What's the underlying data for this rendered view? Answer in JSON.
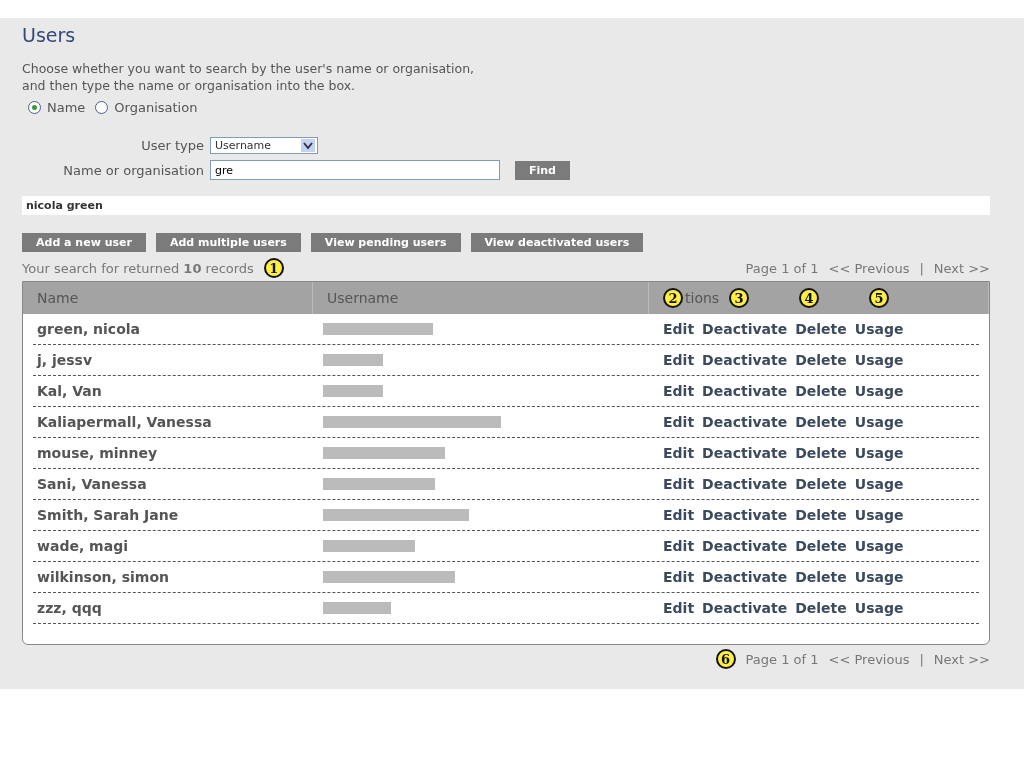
{
  "title": "Users",
  "description": "Choose whether you want to search by the user's name or organisation,\nand then type the name or organisation into the box.",
  "search_by": [
    {
      "label": "Name",
      "selected": true
    },
    {
      "label": "Organisation",
      "selected": false
    }
  ],
  "user_type": {
    "label": "User type",
    "value": "Username"
  },
  "name_field": {
    "label": "Name or organisation",
    "value": "gre"
  },
  "find_button": "Find",
  "suggestion": "nicola green",
  "buttons": [
    "Add a new user",
    "Add multiple users",
    "View pending users",
    "View deactivated users"
  ],
  "result_summary": {
    "before": "Your search for returned ",
    "count": "10",
    "after": " records",
    "marker": "1"
  },
  "pagination_top": {
    "page": "Page 1 of 1",
    "previous": "<< Previous",
    "separator": "|",
    "next": "Next >>"
  },
  "columns": [
    {
      "label": "Name"
    },
    {
      "label": "Username"
    },
    {
      "label": "tions",
      "marker": "2"
    }
  ],
  "action_markers": [
    "3",
    "4",
    "5"
  ],
  "rows": [
    {
      "name": "green, nicola",
      "actions": [
        "Edit",
        "Deactivate",
        "Delete",
        "Usage"
      ]
    },
    {
      "name": "j, jessv",
      "actions": [
        "Edit",
        "Deactivate",
        "Delete",
        "Usage"
      ]
    },
    {
      "name": "Kal, Van",
      "actions": [
        "Edit",
        "Deactivate",
        "Delete",
        "Usage"
      ]
    },
    {
      "name": "Kaliapermall, Vanessa",
      "actions": [
        "Edit",
        "Deactivate",
        "Delete",
        "Usage"
      ]
    },
    {
      "name": "mouse, minney",
      "actions": [
        "Edit",
        "Deactivate",
        "Delete",
        "Usage"
      ]
    },
    {
      "name": "Sani, Vanessa",
      "actions": [
        "Edit",
        "Deactivate",
        "Delete",
        "Usage"
      ]
    },
    {
      "name": "Smith, Sarah Jane",
      "actions": [
        "Edit",
        "Deactivate",
        "Delete",
        "Usage"
      ]
    },
    {
      "name": "wade, magi",
      "actions": [
        "Edit",
        "Deactivate",
        "Delete",
        "Usage"
      ]
    },
    {
      "name": "wilkinson, simon",
      "actions": [
        "Edit",
        "Deactivate",
        "Delete",
        "Usage"
      ]
    },
    {
      "name": "zzz, qqq",
      "actions": [
        "Edit",
        "Deactivate",
        "Delete",
        "Usage"
      ]
    }
  ],
  "pagination_bottom": {
    "marker": "6",
    "page": "Page 1 of 1",
    "previous": "<< Previous",
    "separator": "|",
    "next": "Next >>"
  }
}
